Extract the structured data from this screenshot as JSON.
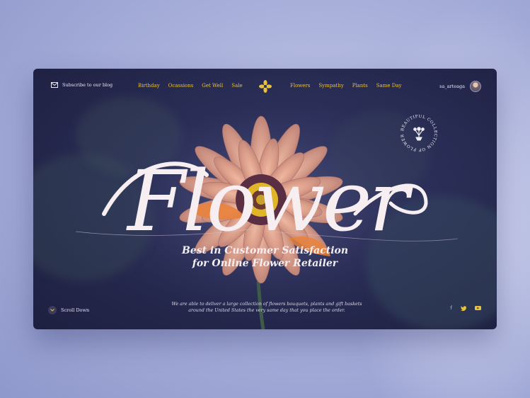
{
  "header": {
    "subscribe_label": "Subscribe to our blog",
    "menu_left": [
      "Birthday",
      "Ocassions",
      "Get Well",
      "Sale"
    ],
    "menu_right": [
      "Flowers",
      "Sympathy",
      "Plants",
      "Same Day"
    ],
    "username": "sa_arteaga"
  },
  "badge": {
    "text": "BEAUTIFUL COLLECTION OF FLOWERS"
  },
  "hero": {
    "script_title": "Flower",
    "tagline_line1": "Best in Customer Satisfaction",
    "tagline_line2": "for Online Flower Retailer"
  },
  "footer": {
    "scroll_label": "Scroll Down",
    "description_line1": "We are able to deliver a large collection of flowers bouquets, plants and gift baskets",
    "description_line2": "around the United States the very same day that you place the order.",
    "social_icons": [
      "facebook-icon",
      "twitter-icon",
      "youtube-icon"
    ]
  },
  "colors": {
    "accent": "#e8c23e",
    "card_bg": "#2b2f58",
    "page_bg": "#a9b0da",
    "petal": "#d9a08a"
  }
}
